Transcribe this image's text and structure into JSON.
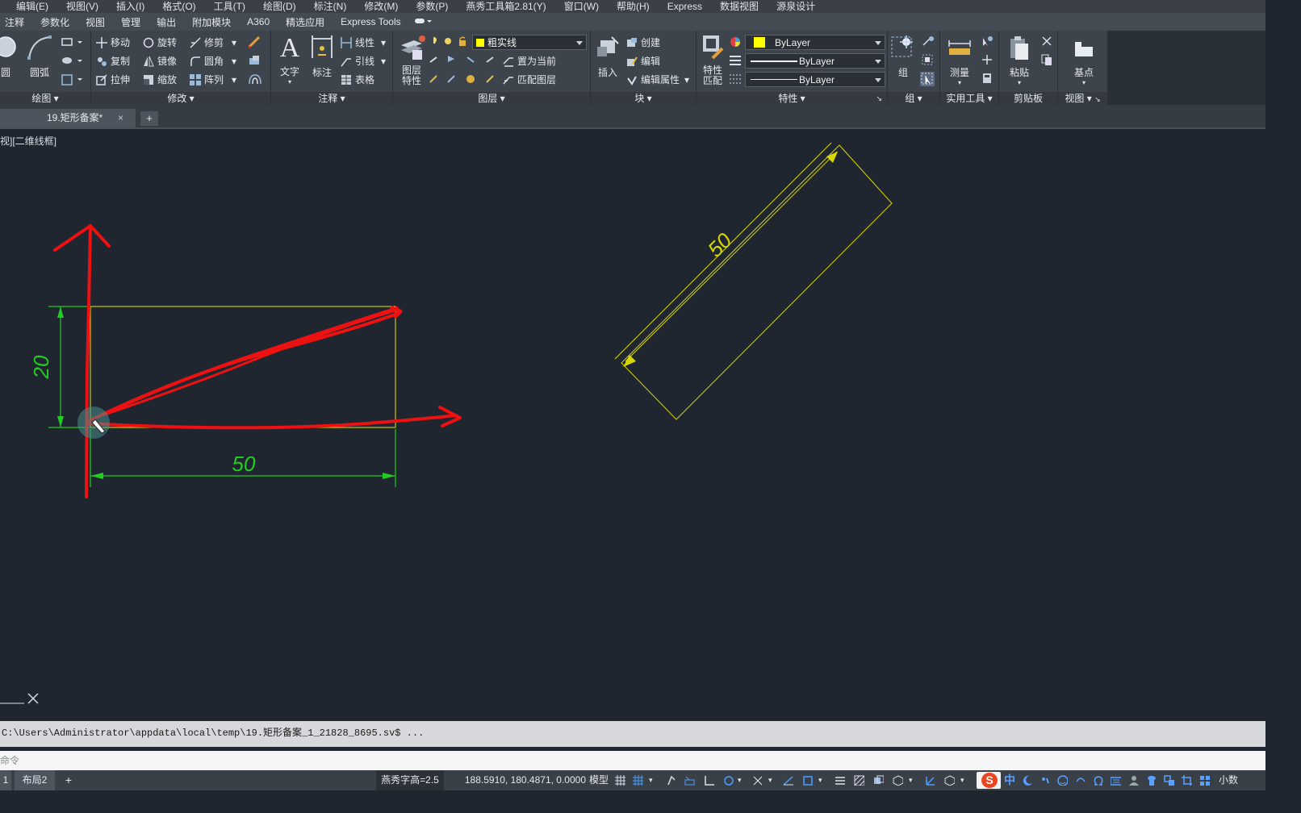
{
  "menubar": {
    "items": [
      "编辑(E)",
      "视图(V)",
      "插入(I)",
      "格式(O)",
      "工具(T)",
      "绘图(D)",
      "标注(N)",
      "修改(M)",
      "参数(P)",
      "燕秀工具箱2.81(Y)",
      "窗口(W)",
      "帮助(H)",
      "Express",
      "数据视图",
      "源泉设计"
    ]
  },
  "ribbon_tabs": [
    "注释",
    "参数化",
    "视图",
    "管理",
    "输出",
    "附加模块",
    "A360",
    "精选应用",
    "Express Tools"
  ],
  "ribbon": {
    "draw": {
      "title": "绘图",
      "circle": "圆",
      "arc": "圆弧"
    },
    "modify": {
      "title": "修改",
      "move": "移动",
      "rotate": "旋转",
      "trim": "修剪",
      "copy": "复制",
      "mirror": "镜像",
      "fillet": "圆角",
      "stretch": "拉伸",
      "scale": "缩放",
      "array": "阵列"
    },
    "annotation": {
      "title": "注释",
      "text": "文字",
      "dimension": "标注",
      "linear": "线性",
      "leader": "引线",
      "table": "表格"
    },
    "layers": {
      "title": "图层",
      "props_l1": "图层",
      "props_l2": "特性",
      "current_layer": "粗实线",
      "make_current": "置为当前",
      "match_layer": "匹配图层"
    },
    "block": {
      "title": "块",
      "insert": "插入",
      "create": "创建",
      "edit": "编辑",
      "edit_attr": "编辑属性"
    },
    "properties": {
      "title": "特性",
      "match_l1": "特性",
      "match_l2": "匹配",
      "color": "ByLayer",
      "linetype": "ByLayer",
      "lineweight": "ByLayer"
    },
    "groups": {
      "title": "组",
      "group": "组"
    },
    "utilities": {
      "title": "实用工具",
      "measure": "测量"
    },
    "clipboard": {
      "title": "剪贴板",
      "paste": "粘贴"
    },
    "view": {
      "title": "视图",
      "basepoint": "基点"
    }
  },
  "doc_tab": {
    "name": "19.矩形备案*",
    "close": "×",
    "add": "+"
  },
  "viewport_label": "视][二维线框]",
  "drawing": {
    "dim_height": "20",
    "dim_width": "50",
    "dim_rotated": "50",
    "colors": {
      "rect": "#e8e800",
      "dim": "#22cc22",
      "markup": "#ee1111",
      "rotated": "#d8d800",
      "bg": "#1f2630"
    }
  },
  "command": {
    "history": "C:\\Users\\Administrator\\appdata\\local\\temp\\19.矩形备案_1_21828_8695.sv$ ...",
    "prompt": "命令"
  },
  "layout_tabs": [
    "1",
    "布局2",
    "+"
  ],
  "status": {
    "text_height": "燕秀字高=2.5",
    "coordinates": "188.5910, 180.4871, 0.0000",
    "model": "模型",
    "units": "小数"
  },
  "ime": {
    "label": "中"
  }
}
